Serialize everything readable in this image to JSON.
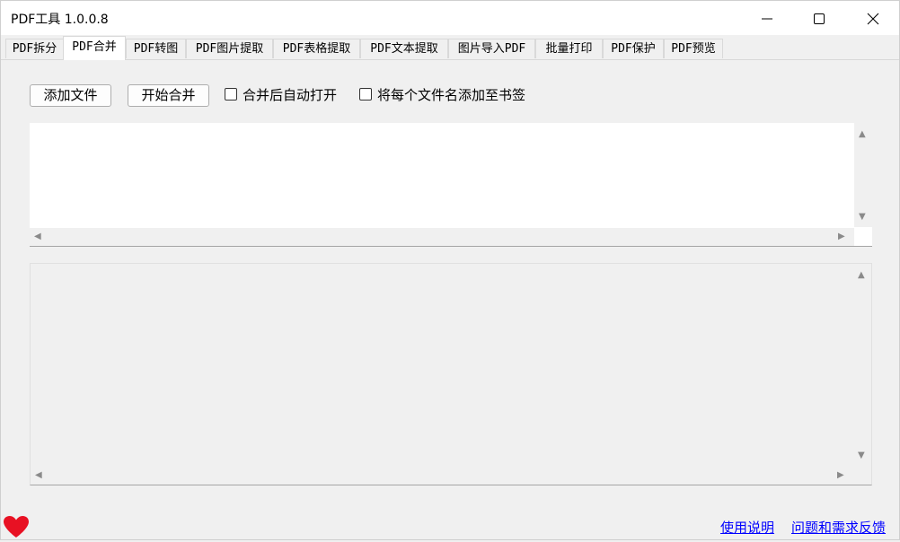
{
  "window": {
    "title": "PDF工具 1.0.0.8"
  },
  "tabs": [
    {
      "label": "PDF拆分"
    },
    {
      "label": "PDF合并"
    },
    {
      "label": "PDF转图"
    },
    {
      "label": "PDF图片提取"
    },
    {
      "label": "PDF表格提取"
    },
    {
      "label": "PDF文本提取"
    },
    {
      "label": "图片导入PDF"
    },
    {
      "label": "批量打印"
    },
    {
      "label": "PDF保护"
    },
    {
      "label": "PDF预览"
    }
  ],
  "active_tab": "PDF合并",
  "toolbar": {
    "add_files": "添加文件",
    "start_merge": "开始合并",
    "auto_open": {
      "label": "合并后自动打开",
      "checked": false
    },
    "bookmark": {
      "label": "将每个文件名添加至书签",
      "checked": false
    }
  },
  "footer": {
    "help": "使用说明",
    "feedback": "问题和需求反馈",
    "heart_color": "#e81123"
  }
}
